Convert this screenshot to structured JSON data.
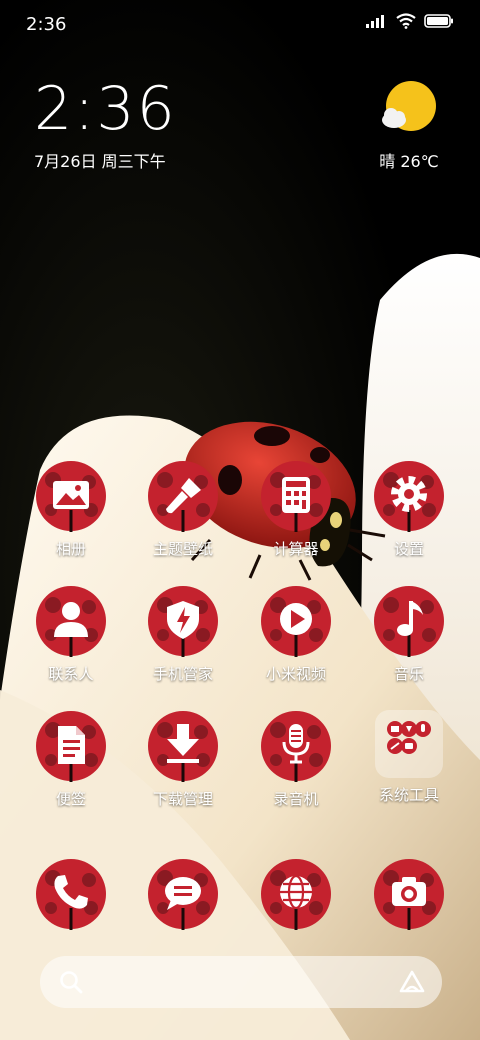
{
  "status_bar": {
    "time": "2:36",
    "icons": [
      "signal-icon",
      "wifi-icon",
      "battery-icon"
    ]
  },
  "clock_widget": {
    "time": "2:36",
    "date": "7月26日 周三下午"
  },
  "weather_widget": {
    "icon": "sun-cloud-icon",
    "text": "晴 26℃"
  },
  "apps": [
    {
      "label": "相册",
      "icon": "gallery-icon"
    },
    {
      "label": "主题壁纸",
      "icon": "paintbrush-icon"
    },
    {
      "label": "计算器",
      "icon": "calculator-icon"
    },
    {
      "label": "设置",
      "icon": "gear-icon"
    },
    {
      "label": "联系人",
      "icon": "person-icon"
    },
    {
      "label": "手机管家",
      "icon": "shield-icon"
    },
    {
      "label": "小米视频",
      "icon": "play-icon"
    },
    {
      "label": "音乐",
      "icon": "music-note-icon"
    },
    {
      "label": "便签",
      "icon": "note-icon"
    },
    {
      "label": "下载管理",
      "icon": "download-icon"
    },
    {
      "label": "录音机",
      "icon": "microphone-icon"
    },
    {
      "label": "系统工具",
      "icon": "folder-icon"
    }
  ],
  "dock": [
    {
      "icon": "phone-icon"
    },
    {
      "icon": "message-icon"
    },
    {
      "icon": "globe-icon"
    },
    {
      "icon": "camera-icon"
    }
  ],
  "search_bar": {
    "left_icon": "search-icon",
    "right_icon": "assistant-icon"
  },
  "colors": {
    "icon_red": "#c4222e",
    "icon_dark": "#8a1a22",
    "sun": "#f5c21b"
  }
}
